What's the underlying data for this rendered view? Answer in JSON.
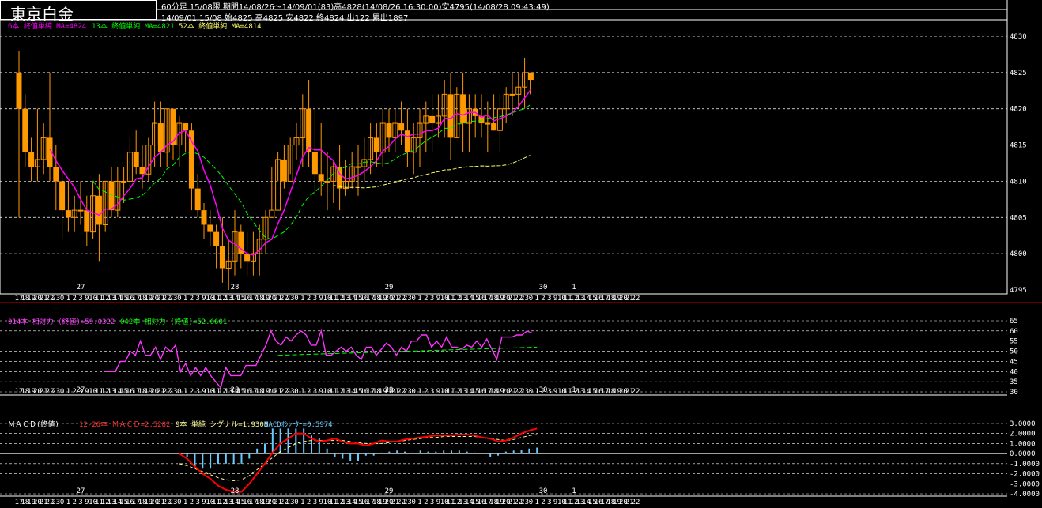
{
  "header": {
    "title": "東京白金",
    "line1": "60分足 15/08限  期間14/08/26～14/09/01(83)高4828(14/08/26 16:30:00)安4795(14/08/28 09:43:49)",
    "line2": "14/09/01 15/08 始4825 高4825 安4822 終4824 出122 累出1897"
  },
  "legend": {
    "ma6": "6本 終値単純 MA=4824",
    "ma13": "13本 終値単純 MA=4821",
    "ma52": "52本 終値単純 MA=4814",
    "rsi14": "014本 相対力 (終値)=59.0322",
    "rsi42": "042本 相対力 (終値)=52.6601",
    "macd_title": "ＭＡＣＤ(終値)",
    "macd_val": "12-26本 ＭＡＣＤ=2.5282",
    "signal_val": "9本 単純 シグナル=1.9308",
    "osc_val": "MACDｵｼﾚｰﾀｰ=0.5974"
  },
  "colors": {
    "candle": "#ff9900",
    "ma6": "#ff00ff",
    "ma13": "#00ff00",
    "ma52": "#ffff66",
    "rsi14": "#ff33ff",
    "rsi42": "#00ff00",
    "macd": "#ff0000",
    "signal": "#ffff99",
    "osc": "#66ccff"
  },
  "chart_data": [
    {
      "type": "candlestick",
      "ylim": [
        4795,
        4830
      ],
      "yticks": [
        4795,
        4800,
        4805,
        4810,
        4815,
        4820,
        4825,
        4830
      ],
      "day_labels": [
        {
          "label": "27",
          "index": 10
        },
        {
          "label": "28",
          "index": 35
        },
        {
          "label": "29",
          "index": 60
        },
        {
          "label": "30",
          "index": 85
        },
        {
          "label": "1",
          "index": 90
        }
      ],
      "hour_ticks": [
        "17",
        "18",
        "19",
        "20",
        "21",
        "22",
        "23",
        "0",
        "1",
        "2",
        "3",
        "9",
        "10",
        "11",
        "12",
        "13",
        "14",
        "15",
        "16",
        "17",
        "18",
        "19",
        "20",
        "21",
        "22",
        "23",
        "0",
        "1",
        "2",
        "3",
        "9",
        "10",
        "11",
        "12",
        "13",
        "14",
        "15",
        "16",
        "17",
        "18",
        "19",
        "20",
        "21",
        "22",
        "23",
        "0",
        "1",
        "2",
        "3",
        "9",
        "10",
        "11",
        "12",
        "13",
        "14",
        "15",
        "16",
        "17",
        "18",
        "19",
        "20",
        "21",
        "22",
        "23",
        "0",
        "1",
        "2",
        "3",
        "9",
        "10",
        "11",
        "12",
        "13",
        "14",
        "15",
        "16",
        "17",
        "18",
        "19",
        "20",
        "21",
        "22",
        "23",
        "0",
        "1",
        "2",
        "3",
        "9",
        "10",
        "11",
        "12",
        "13",
        "14",
        "15",
        "16",
        "17",
        "18",
        "19",
        "20",
        "21",
        "22"
      ],
      "candles": [
        [
          4825,
          4828,
          4805,
          4820
        ],
        [
          4820,
          4822,
          4812,
          4814
        ],
        [
          4814,
          4816,
          4810,
          4812
        ],
        [
          4812,
          4820,
          4810,
          4813
        ],
        [
          4813,
          4818,
          4811,
          4816
        ],
        [
          4816,
          4825,
          4810,
          4812
        ],
        [
          4812,
          4815,
          4806,
          4810
        ],
        [
          4810,
          4812,
          4802,
          4806
        ],
        [
          4806,
          4810,
          4803,
          4805
        ],
        [
          4805,
          4808,
          4803,
          4806
        ],
        [
          4806,
          4810,
          4804,
          4806
        ],
        [
          4806,
          4808,
          4801,
          4803
        ],
        [
          4803,
          4810,
          4802,
          4808
        ],
        [
          4808,
          4811,
          4799,
          4804
        ],
        [
          4804,
          4810,
          4803,
          4810
        ],
        [
          4810,
          4812,
          4805,
          4806
        ],
        [
          4806,
          4812,
          4805,
          4810
        ],
        [
          4810,
          4812,
          4807,
          4810
        ],
        [
          4810,
          4816,
          4808,
          4814
        ],
        [
          4814,
          4817,
          4811,
          4812
        ],
        [
          4812,
          4815,
          4809,
          4811
        ],
        [
          4811,
          4816,
          4810,
          4815
        ],
        [
          4815,
          4821,
          4812,
          4818
        ],
        [
          4818,
          4821,
          4812,
          4814
        ],
        [
          4814,
          4820,
          4812,
          4820
        ],
        [
          4820,
          4820,
          4813,
          4815
        ],
        [
          4815,
          4819,
          4812,
          4818
        ],
        [
          4818,
          4818,
          4814,
          4817
        ],
        [
          4817,
          4818,
          4806,
          4809
        ],
        [
          4809,
          4811,
          4805,
          4806
        ],
        [
          4806,
          4807,
          4802,
          4804
        ],
        [
          4804,
          4806,
          4801,
          4803
        ],
        [
          4803,
          4804,
          4798,
          4801
        ],
        [
          4801,
          4805,
          4796,
          4798
        ],
        [
          4798,
          4802,
          4795,
          4799
        ],
        [
          4799,
          4806,
          4797,
          4803
        ],
        [
          4803,
          4804,
          4798,
          4800
        ],
        [
          4800,
          4803,
          4797,
          4799
        ],
        [
          4799,
          4803,
          4797,
          4800
        ],
        [
          4800,
          4804,
          4797,
          4802
        ],
        [
          4802,
          4806,
          4800,
          4805
        ],
        [
          4805,
          4812,
          4806,
          4806
        ],
        [
          4806,
          4814,
          4810,
          4813
        ],
        [
          4813,
          4815,
          4809,
          4810
        ],
        [
          4810,
          4816,
          4811,
          4815
        ],
        [
          4815,
          4818,
          4813,
          4816
        ],
        [
          4816,
          4822,
          4812,
          4820
        ],
        [
          4820,
          4824,
          4812,
          4814
        ],
        [
          4814,
          4820,
          4808,
          4811
        ],
        [
          4811,
          4818,
          4808,
          4810
        ],
        [
          4810,
          4814,
          4806,
          4810
        ],
        [
          4810,
          4813,
          4807,
          4812
        ],
        [
          4812,
          4815,
          4806,
          4809
        ],
        [
          4809,
          4813,
          4808,
          4810
        ],
        [
          4810,
          4814,
          4809,
          4812
        ],
        [
          4812,
          4815,
          4808,
          4812
        ],
        [
          4812,
          4816,
          4810,
          4813
        ],
        [
          4813,
          4818,
          4811,
          4816
        ],
        [
          4816,
          4818,
          4812,
          4814
        ],
        [
          4814,
          4820,
          4812,
          4818
        ],
        [
          4818,
          4820,
          4814,
          4816
        ],
        [
          4816,
          4820,
          4814,
          4818
        ],
        [
          4818,
          4821,
          4815,
          4817
        ],
        [
          4817,
          4820,
          4812,
          4814
        ],
        [
          4814,
          4818,
          4811,
          4816
        ],
        [
          4816,
          4820,
          4812,
          4818
        ],
        [
          4818,
          4821,
          4814,
          4819
        ],
        [
          4819,
          4822,
          4814,
          4818
        ],
        [
          4818,
          4822,
          4816,
          4819
        ],
        [
          4819,
          4824,
          4816,
          4822
        ],
        [
          4822,
          4825,
          4813,
          4816
        ],
        [
          4816,
          4823,
          4816,
          4822
        ],
        [
          4822,
          4825,
          4814,
          4818
        ],
        [
          4818,
          4822,
          4814,
          4820
        ],
        [
          4820,
          4822,
          4816,
          4819
        ],
        [
          4819,
          4822,
          4816,
          4818
        ],
        [
          4818,
          4821,
          4814,
          4818
        ],
        [
          4818,
          4822,
          4817,
          4817
        ],
        [
          4817,
          4822,
          4814,
          4820
        ],
        [
          4820,
          4823,
          4818,
          4822
        ],
        [
          4822,
          4825,
          4819,
          4822
        ],
        [
          4822,
          4825,
          4820,
          4823
        ],
        [
          4823,
          4827,
          4820,
          4825
        ],
        [
          4825,
          4825,
          4822,
          4824
        ]
      ],
      "ma6": [
        4818,
        4818,
        4816,
        4815,
        4814,
        4813,
        4811,
        4808,
        4806,
        4806,
        4806,
        4807,
        4808,
        4808,
        4809,
        4810,
        4811,
        4813,
        4814,
        4815,
        4816,
        4815,
        4813,
        4810,
        4808,
        4806,
        4804,
        4802,
        4800,
        4799,
        4800,
        4801,
        4803,
        4806,
        4808,
        4811,
        4814,
        4816,
        4815,
        4813,
        4812,
        4811,
        4811,
        4810,
        4811,
        4812,
        4813,
        4814,
        4815,
        4816,
        4816,
        4817,
        4818,
        4819,
        4819,
        4820,
        4820,
        4820,
        4821,
        4822,
        4823,
        4824
      ]
    },
    {
      "type": "line",
      "ylim": [
        30,
        65
      ],
      "yticks": [
        30,
        35,
        40,
        45,
        50,
        55,
        60,
        65
      ],
      "series": [
        {
          "name": "rsi14",
          "values": [
            40,
            40,
            40,
            45,
            45,
            50,
            48,
            55,
            48,
            48,
            52,
            46,
            52,
            50,
            53,
            40,
            44,
            38,
            42,
            38,
            42,
            38,
            35,
            32,
            42,
            38,
            38,
            38,
            43,
            43,
            43,
            48,
            53,
            60,
            55,
            53,
            57,
            55,
            58,
            60,
            58,
            53,
            53,
            60,
            48,
            48,
            50,
            52,
            50,
            52,
            48,
            46,
            52,
            52,
            48,
            51,
            54,
            52,
            48,
            52,
            50,
            55,
            55,
            58,
            58,
            52,
            55,
            52,
            57,
            52,
            52,
            51,
            53,
            52,
            55,
            52,
            56,
            51,
            46,
            57,
            57,
            57,
            58,
            58,
            60,
            59
          ]
        }
      ]
    },
    {
      "type": "line",
      "ylim": [
        -4,
        3
      ],
      "yticks": [
        -4,
        -3,
        -2,
        -1,
        0,
        1,
        2,
        3
      ],
      "series": [
        {
          "name": "macd",
          "values": [
            0,
            -0.5,
            -1.3,
            -2,
            -2.5,
            -3.2,
            -3.6,
            -3.8,
            -3.8,
            -3.0,
            -2,
            -1,
            0.1,
            1,
            1.5,
            2,
            2.0,
            1.5,
            1.2,
            1.3,
            1.5,
            1.2,
            1.0,
            1.0,
            0.8,
            1.0,
            1.3,
            1.2,
            1.2,
            1.4,
            1.5,
            1.6,
            1.7,
            1.8,
            1.8,
            1.8,
            1.9,
            1.9,
            1.8,
            1.6,
            1.5,
            1.2,
            1.3,
            1.6,
            2.0,
            2.3,
            2.5
          ]
        },
        {
          "name": "signal",
          "values": [
            -1,
            -1.2,
            -1.5,
            -1.8,
            -2.1,
            -2.4,
            -2.6,
            -2.7,
            -2.6,
            -2.2,
            -1.6,
            -1.0,
            -0.4,
            0.2,
            0.6,
            1.0,
            1.2,
            1.3,
            1.3,
            1.3,
            1.3,
            1.3,
            1.2,
            1.1,
            1.0,
            1.0,
            1.0,
            1.1,
            1.2,
            1.3,
            1.4,
            1.5,
            1.6,
            1.6,
            1.7,
            1.7,
            1.7,
            1.7,
            1.7,
            1.6,
            1.5,
            1.4,
            1.3,
            1.4,
            1.6,
            1.8,
            1.9
          ]
        },
        {
          "name": "osc",
          "values": [
            0,
            -0.3,
            -1.5,
            -1.5,
            -1.5,
            -1.0,
            -1.0,
            -1.0,
            -1.0,
            -0.5,
            0.5,
            1.0,
            2.5,
            2.5,
            2.5,
            2.5,
            2.5,
            1.8,
            1.5,
            0.5,
            -0.3,
            -0.5,
            -0.7,
            -0.7,
            -0.2,
            -0.2,
            0.1,
            0.2,
            0.3,
            0.2,
            0.1,
            0.3,
            0.2,
            0.2,
            0.3,
            0.3,
            0.3,
            0.2,
            0.1,
            0.0,
            -0.3,
            -0.2,
            0.2,
            0.3,
            0.4,
            0.5,
            0.6
          ]
        }
      ]
    }
  ]
}
